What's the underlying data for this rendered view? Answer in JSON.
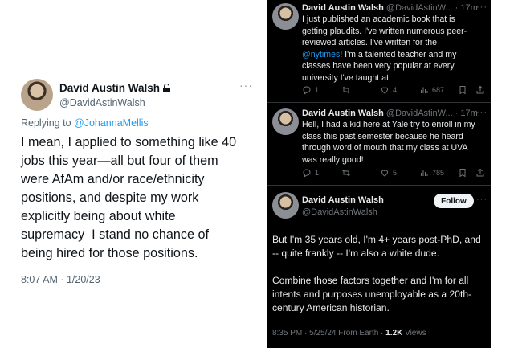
{
  "left_tweet": {
    "name": "David Austin Walsh",
    "handle": "@DavidAstinWalsh",
    "more": "···",
    "replying_prefix": "Replying to ",
    "replying_to": "@JohannaMellis",
    "text": "I mean, I applied to something like 40\njobs this year—all but four of them\nwere AfAm and/or race/ethnicity\npositions, and despite my work\nexplicitly being about white\nsupremacy  I stand no chance of\nbeing hired for those positions.",
    "timestamp": "8:07 AM · 1/20/23"
  },
  "right_thread": {
    "tweets": [
      {
        "name": "David Austin Walsh",
        "meta": " @DavidAstinW... · 17m",
        "more": "···",
        "text_before": "I just published an academic book that is\ngetting plaudits. I've written numerous peer-\nreviewed articles. I've written for the\n",
        "mention": "@nytimes",
        "text_after": "! I'm a talented teacher and my\nclasses have been very popular at every\nuniversity I've taught at.",
        "replies": "1",
        "retweets": "",
        "likes": "4",
        "views": "687"
      },
      {
        "name": "David Austin Walsh",
        "meta": " @DavidAstinW... · 17m",
        "more": "···",
        "text": "Hell, I had a kid here at Yale try to enroll in my\nclass this past semester because he heard\nthrough word of mouth that my class at UVA\nwas really good!",
        "replies": "1",
        "retweets": "",
        "likes": "5",
        "views": "785"
      }
    ],
    "main": {
      "name": "David Austin Walsh",
      "handle": "@DavidAstinWalsh",
      "follow_label": "Follow",
      "more": "···",
      "paragraph1": "But I'm 35 years old, I'm 4+ years post-PhD, and\n-- quite frankly -- I'm also a white dude.",
      "paragraph2": "Combine those factors together and I'm for all\nintents and purposes unemployable as a 20th-\ncentury American historian.",
      "footer_time": "8:35 PM · 5/25/24 From Earth · ",
      "footer_views": "1.2K",
      "footer_views_label": " Views"
    }
  }
}
